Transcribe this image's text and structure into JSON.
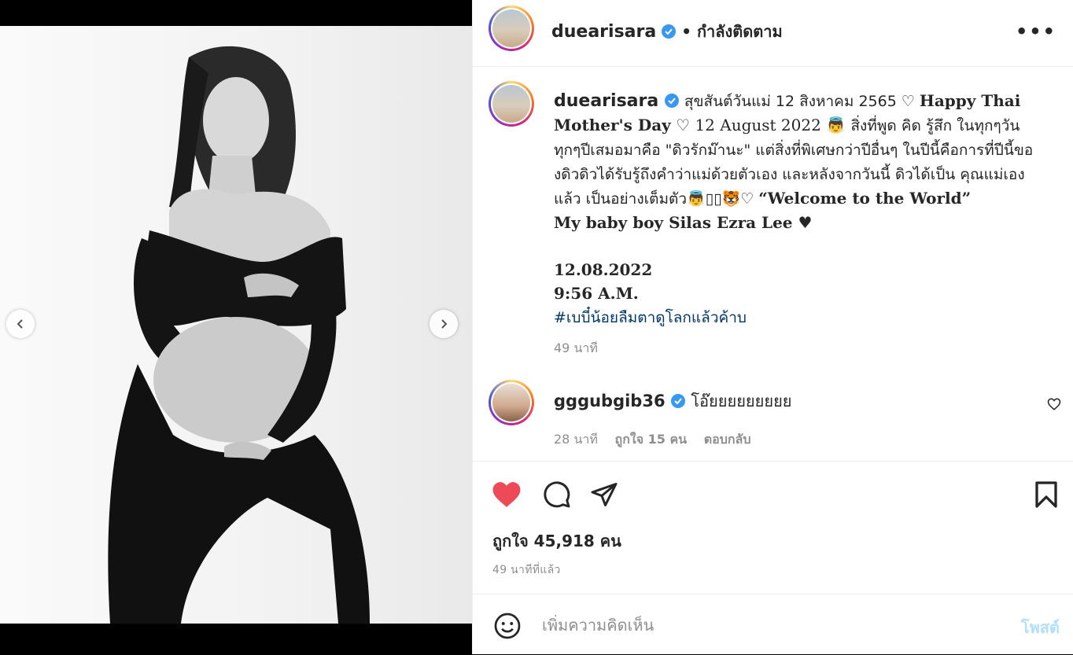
{
  "post": {
    "username": "duearisara",
    "follow_state": "• กำลังติดตาม",
    "more_label": "•••"
  },
  "caption": {
    "username": "duearisara",
    "line_parts": {
      "p1": "สุขสันต์วันแม่ 12 สิงหาคม 2565 ♡ ",
      "p2": "Happy Thai Mother's Day",
      "p3": " ♡ 12 August 2022 👼 ",
      "p4": "สิ่งที่พูด คิด รู้สึก ในทุกๆวัน ทุกๆปีเสมอมาคือ \"ดิวรักม๊านะ\" แต่สิ่งที่พิเศษกว่าปีอื่นๆ ในปีนี้คือการที่ปีนี้ของดิวดิวได้รับรู้ถึงคำว่าแม่ด้วยตัวเอง และหลังจากวันนี้ ดิวได้เป็น คุณแม่เองแล้ว เป็นอย่างเต็มตัว👼▯▯🐯♡ ",
      "p5": "“Welcome to the World”",
      "p6": "My baby boy Silas Ezra Lee ♥"
    },
    "date": "12.08.2022",
    "time": "9:56 A.M.",
    "hashtag": "#เบบี๋น้อยลืมตาดูโลกแล้วค้าบ",
    "posted_ago": "49 นาที"
  },
  "comment": {
    "username": "gggubgib36",
    "text": "โอ๊ยยยยยยยยย",
    "ago": "28 นาที",
    "likes": "ถูกใจ 15 คน",
    "reply": "ตอบกลับ"
  },
  "engagement": {
    "likes_text": "ถูกใจ 45,918 คน",
    "ago_text": "49 นาทีที่แล้ว",
    "liked": true
  },
  "add_comment": {
    "placeholder": "เพิ่มความคิดเห็น",
    "post_label": "โพสต์"
  },
  "colors": {
    "like_red": "#ed4956",
    "verified_blue": "#3897f0",
    "hashtag_blue": "#00376b",
    "post_disabled": "#b2dffc"
  }
}
